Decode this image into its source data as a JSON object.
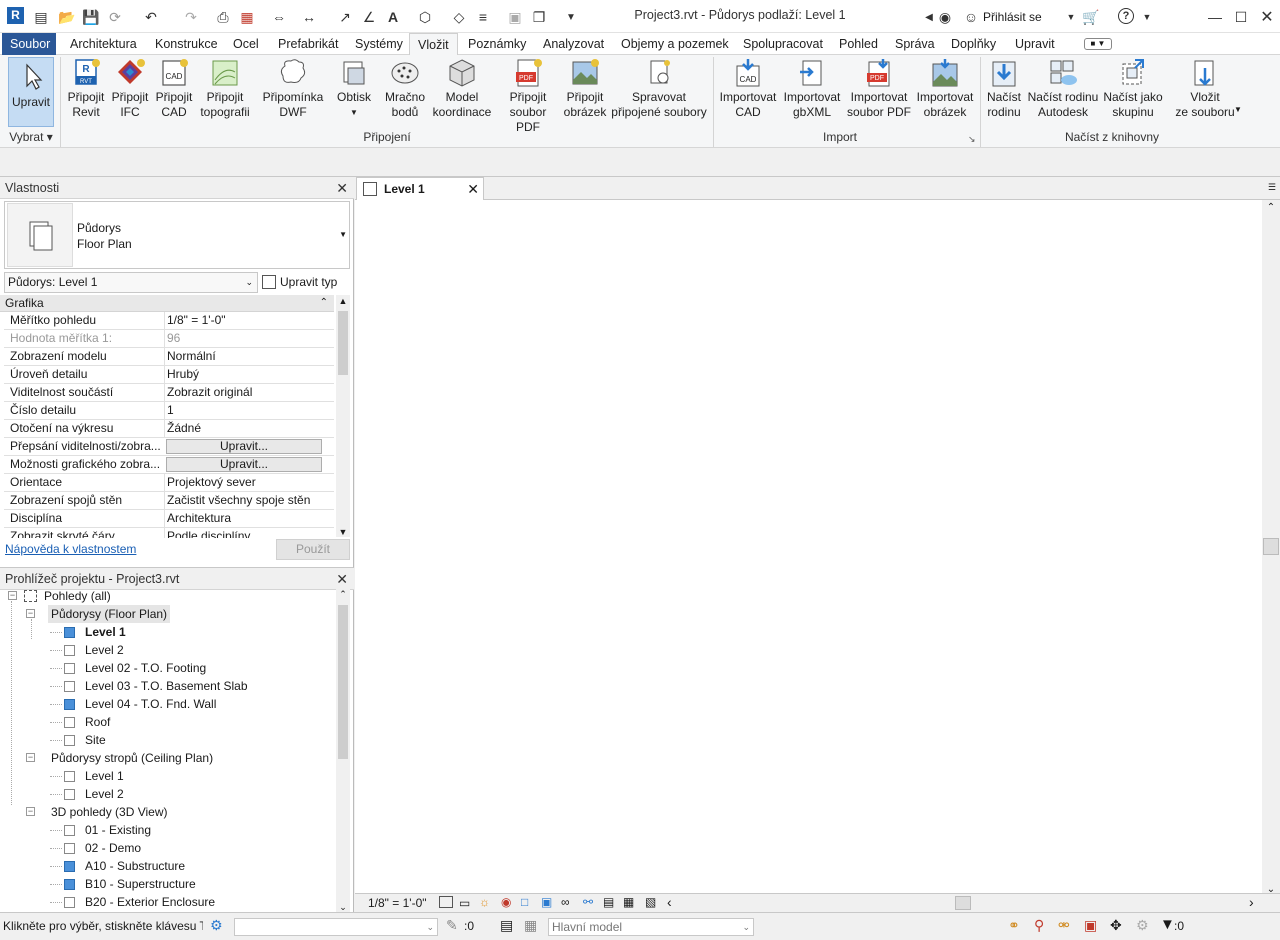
{
  "app": {
    "logo_letter": "R",
    "title": "Project3.rvt - Půdorys podlaží: Level 1",
    "signin": "Přihlásit se"
  },
  "menu": {
    "tabs": [
      "Soubor",
      "Architektura",
      "Konstrukce",
      "Ocel",
      "Prefabrikát",
      "Systémy",
      "Vložit",
      "Poznámky",
      "Analyzovat",
      "Objemy a pozemek",
      "Spolupracovat",
      "Pohled",
      "Správa",
      "Doplňky",
      "Upravit"
    ],
    "active": "Vložit"
  },
  "ribbon": {
    "select_button": "Upravit",
    "select_group": "Vybrat",
    "buttons": [
      {
        "l1": "Připojit",
        "l2": "Revit",
        "icon": "rvt-link-icon"
      },
      {
        "l1": "Připojit",
        "l2": "IFC",
        "icon": "ifc-link-icon"
      },
      {
        "l1": "Připojit",
        "l2": "CAD",
        "icon": "cad-link-icon"
      },
      {
        "l1": "Připojit",
        "l2": "topografii",
        "icon": "topography-link-icon"
      },
      {
        "l1": "Připomínka",
        "l2": "DWF",
        "icon": "dwf-markup-icon"
      },
      {
        "l1": "Obtisk",
        "l2": "",
        "icon": "decal-icon"
      },
      {
        "l1": "Mračno",
        "l2": "bodů",
        "icon": "point-cloud-icon"
      },
      {
        "l1": "Model",
        "l2": "koordinace",
        "icon": "coordination-model-icon"
      },
      {
        "l1": "Připojit",
        "l2": "soubor PDF",
        "icon": "pdf-link-icon"
      },
      {
        "l1": "Připojit",
        "l2": "obrázek",
        "icon": "image-link-icon"
      },
      {
        "l1": "Spravovat",
        "l2": "připojené soubory",
        "icon": "manage-links-icon"
      },
      {
        "l1": "Importovat",
        "l2": "CAD",
        "icon": "import-cad-icon"
      },
      {
        "l1": "Importovat",
        "l2": "gbXML",
        "icon": "import-gbxml-icon"
      },
      {
        "l1": "Importovat",
        "l2": "soubor PDF",
        "icon": "import-pdf-icon"
      },
      {
        "l1": "Importovat",
        "l2": "obrázek",
        "icon": "import-image-icon"
      },
      {
        "l1": "Načíst",
        "l2": "rodinu",
        "icon": "load-family-icon"
      },
      {
        "l1": "Načíst rodinu",
        "l2": "Autodesk",
        "icon": "load-autodesk-family-icon"
      },
      {
        "l1": "Načíst jako",
        "l2": "skupinu",
        "icon": "load-as-group-icon"
      },
      {
        "l1": "Vložit",
        "l2": "ze souboru",
        "icon": "insert-from-file-icon"
      }
    ],
    "groups": {
      "link": "Připojení",
      "import": "Import",
      "library": "Načíst z knihovny"
    },
    "icon_texts": {
      "rvt": "RVT",
      "cad": "CAD",
      "pdf": "PDF"
    }
  },
  "properties": {
    "title": "Vlastnosti",
    "type_name_1": "Půdorys",
    "type_name_2": "Floor Plan",
    "instance_select": "Půdorys: Level 1",
    "edit_type": "Upravit typ",
    "section": "Grafika",
    "rows": [
      {
        "k": "Měřítko pohledu",
        "v": "1/8\" = 1'-0\""
      },
      {
        "k": "Hodnota měřítka    1:",
        "v": "96"
      },
      {
        "k": "Zobrazení modelu",
        "v": "Normální"
      },
      {
        "k": "Úroveň detailu",
        "v": "Hrubý"
      },
      {
        "k": "Viditelnost součástí",
        "v": "Zobrazit originál"
      },
      {
        "k": "Číslo detailu",
        "v": "1"
      },
      {
        "k": "Otočení na výkresu",
        "v": "Žádné"
      },
      {
        "k": "Přepsání viditelnosti/zobra...",
        "v": "Upravit..."
      },
      {
        "k": "Možnosti grafického zobra...",
        "v": "Upravit..."
      },
      {
        "k": "Orientace",
        "v": "Projektový sever"
      },
      {
        "k": "Zobrazení spojů stěn",
        "v": "Začistit všechny spoje stěn"
      },
      {
        "k": "Disciplína",
        "v": "Architektura"
      },
      {
        "k": "Zobrazit skryté čáry",
        "v": "Podle disciplíny"
      }
    ],
    "help_link": "Nápověda k vlastnostem",
    "apply": "Použít"
  },
  "browser": {
    "title": "Prohlížeč projektu - Project3.rvt",
    "root": "Pohledy (all)",
    "groups": [
      {
        "label": "Půdorysy (Floor Plan)",
        "items": [
          {
            "label": "Level 1",
            "blue": true,
            "bold": true
          },
          {
            "label": "Level 2",
            "blue": false,
            "bold": false
          },
          {
            "label": "Level 02 - T.O. Footing",
            "blue": false,
            "bold": false
          },
          {
            "label": "Level 03 - T.O. Basement Slab",
            "blue": false,
            "bold": false
          },
          {
            "label": "Level 04 - T.O. Fnd. Wall",
            "blue": true,
            "bold": false
          },
          {
            "label": "Roof",
            "blue": false,
            "bold": false
          },
          {
            "label": "Site",
            "blue": false,
            "bold": false
          }
        ]
      },
      {
        "label": "Půdorysy stropů (Ceiling Plan)",
        "items": [
          {
            "label": "Level 1",
            "blue": false,
            "bold": false
          },
          {
            "label": "Level 2",
            "blue": false,
            "bold": false
          }
        ]
      },
      {
        "label": "3D pohledy (3D View)",
        "items": [
          {
            "label": "01 - Existing",
            "blue": false,
            "bold": false
          },
          {
            "label": "02 - Demo",
            "blue": false,
            "bold": false
          },
          {
            "label": "A10 - Substructure",
            "blue": true,
            "bold": false
          },
          {
            "label": "B10 - Superstructure",
            "blue": true,
            "bold": false
          },
          {
            "label": "B20 - Exterior Enclosure",
            "blue": false,
            "bold": false
          }
        ]
      }
    ]
  },
  "view": {
    "tab": "Level 1",
    "scale": "1/8\" = 1'-0\""
  },
  "status": {
    "message": "Klikněte pro výběr, stiskněte klávesu Ta",
    "count_a": ":0",
    "model": "Hlavní model",
    "filter_count": ":0"
  },
  "colors": {
    "accent": "#2b5797",
    "selection_blue": "#4a90d9"
  }
}
